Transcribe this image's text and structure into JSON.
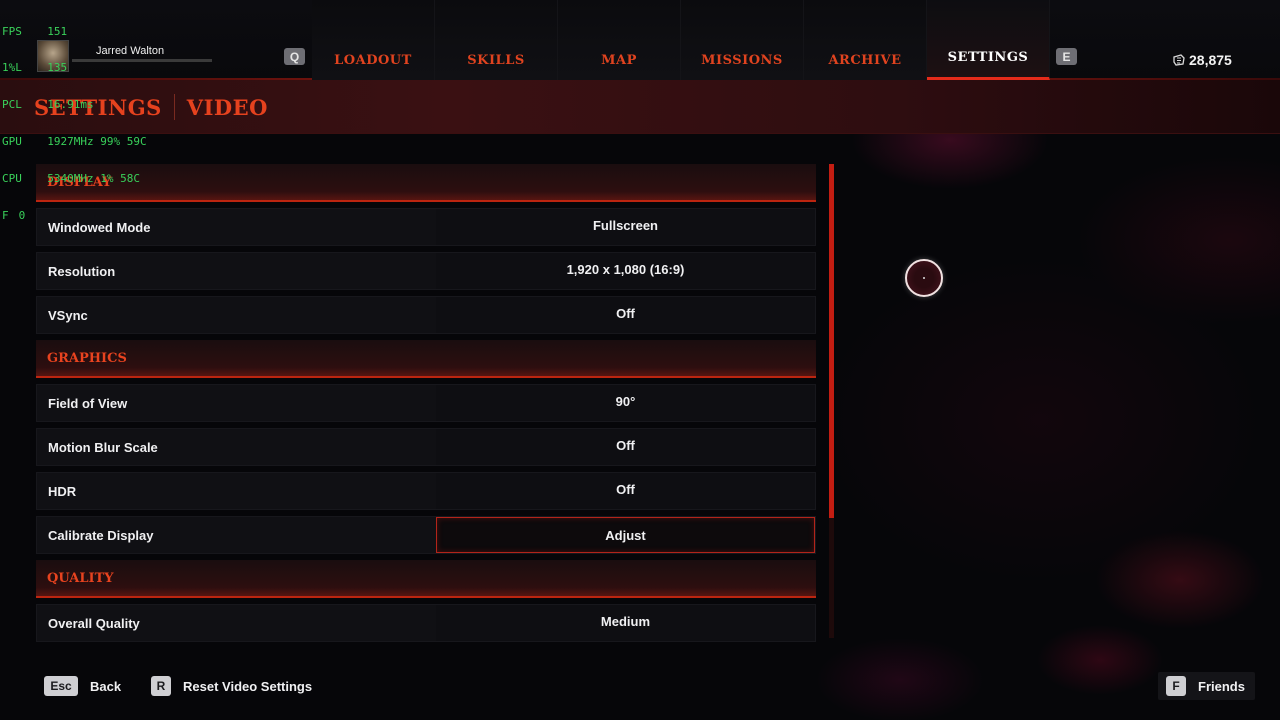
{
  "overlay": {
    "lines": [
      {
        "label": "FPS",
        "value": "151"
      },
      {
        "label": "1%L",
        "value": "135"
      },
      {
        "label": "PCL",
        "value": "16.91ms"
      },
      {
        "label": "GPU",
        "value": "1927MHz 99% 59C"
      },
      {
        "label": "CPU",
        "value": "5340MHz 1% 58C"
      },
      {
        "label": "F",
        "value": "0"
      }
    ]
  },
  "player": {
    "name": "Jarred Walton"
  },
  "nav": {
    "prev_key": "Q",
    "next_key": "E",
    "tabs": [
      {
        "label": "LOADOUT"
      },
      {
        "label": "SKILLS"
      },
      {
        "label": "MAP"
      },
      {
        "label": "MISSIONS"
      },
      {
        "label": "ARCHIVE"
      },
      {
        "label": "SETTINGS",
        "active": true
      }
    ],
    "currency": "28,875"
  },
  "breadcrumb": {
    "root": "SETTINGS",
    "current": "VIDEO"
  },
  "sections": {
    "display": "DISPLAY",
    "graphics": "GRAPHICS",
    "quality": "QUALITY"
  },
  "settings": {
    "windowed_mode": {
      "label": "Windowed Mode",
      "value": "Fullscreen"
    },
    "resolution": {
      "label": "Resolution",
      "value": "1,920 x 1,080 (16:9)"
    },
    "vsync": {
      "label": "VSync",
      "value": "Off"
    },
    "fov": {
      "label": "Field of View",
      "value": "90°"
    },
    "motion_blur": {
      "label": "Motion Blur Scale",
      "value": "Off"
    },
    "hdr": {
      "label": "HDR",
      "value": "Off"
    },
    "calibrate": {
      "label": "Calibrate Display",
      "value": "Adjust"
    },
    "overall_quality": {
      "label": "Overall Quality",
      "value": "Medium"
    }
  },
  "footer": {
    "back": {
      "key": "Esc",
      "label": "Back"
    },
    "reset": {
      "key": "R",
      "label": "Reset Video Settings"
    },
    "friends": {
      "key": "F",
      "label": "Friends"
    }
  },
  "colors": {
    "accent": "#e0431f",
    "active_tab": "#ffffff",
    "scrollbar": "#c31d12"
  }
}
